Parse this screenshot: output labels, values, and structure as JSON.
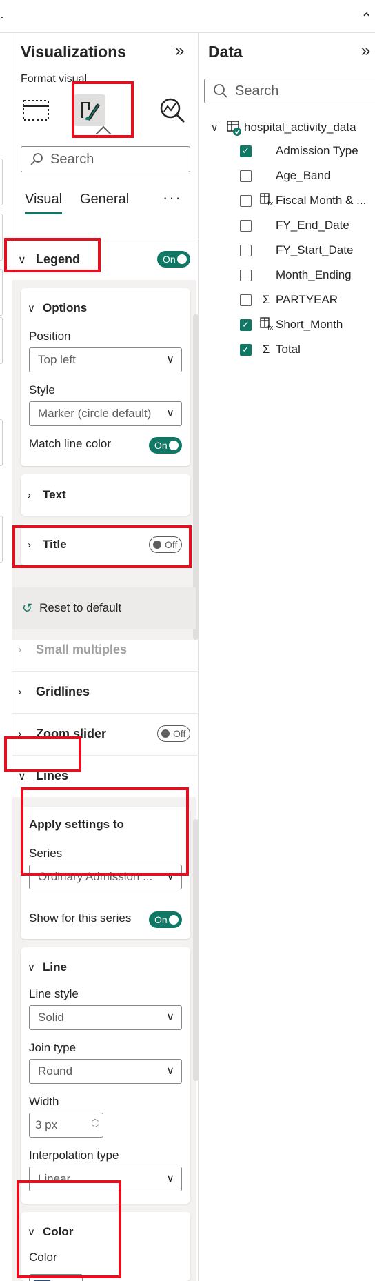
{
  "viz_pane": {
    "title": "Visualizations",
    "format_label": "Format visual",
    "icons": [
      "build-visual-icon",
      "format-visual-icon",
      "analytics-icon"
    ],
    "search_placeholder": "Search",
    "tabs": [
      "Visual",
      "General"
    ],
    "more": "···",
    "legend": {
      "label": "Legend",
      "toggle": "On",
      "options": {
        "label": "Options",
        "position_label": "Position",
        "position_value": "Top left",
        "style_label": "Style",
        "style_value": "Marker (circle default)",
        "match_label": "Match line color",
        "match_toggle": "On"
      },
      "text_label": "Text",
      "title_label": "Title",
      "title_toggle": "Off",
      "reset_label": "Reset to default"
    },
    "small_multiples_label": "Small multiples",
    "gridlines_label": "Gridlines",
    "zoom_label": "Zoom slider",
    "zoom_toggle": "Off",
    "lines": {
      "label": "Lines",
      "apply_label": "Apply settings to",
      "series_label": "Series",
      "series_value": "Ordinary Admission ...",
      "show_label": "Show for this series",
      "show_toggle": "On",
      "line_label": "Line",
      "line_style_label": "Line style",
      "line_style_value": "Solid",
      "join_label": "Join type",
      "join_value": "Round",
      "width_label": "Width",
      "width_value": "3 px",
      "interp_label": "Interpolation type",
      "interp_value": "Linear",
      "color_section_label": "Color",
      "color_label": "Color",
      "color_value": "#1f4e8c"
    }
  },
  "data_pane": {
    "title": "Data",
    "search_placeholder": "Search",
    "table_name": "hospital_activity_data",
    "fields": [
      {
        "name": "Admission Type",
        "checked": true,
        "type": "none"
      },
      {
        "name": "Age_Band",
        "checked": false,
        "type": "none"
      },
      {
        "name": "Fiscal Month & ...",
        "checked": false,
        "type": "calc-icon"
      },
      {
        "name": "FY_End_Date",
        "checked": false,
        "type": "none"
      },
      {
        "name": "FY_Start_Date",
        "checked": false,
        "type": "none"
      },
      {
        "name": "Month_Ending",
        "checked": false,
        "type": "none"
      },
      {
        "name": "PARTYEAR",
        "checked": false,
        "type": "sigma-icon"
      },
      {
        "name": "Short_Month",
        "checked": true,
        "type": "calc-icon"
      },
      {
        "name": "Total",
        "checked": true,
        "type": "sigma-icon"
      }
    ]
  },
  "colors": {
    "accent": "#117865",
    "highlight": "#e3111f",
    "series_color": "#1f4e8c"
  }
}
